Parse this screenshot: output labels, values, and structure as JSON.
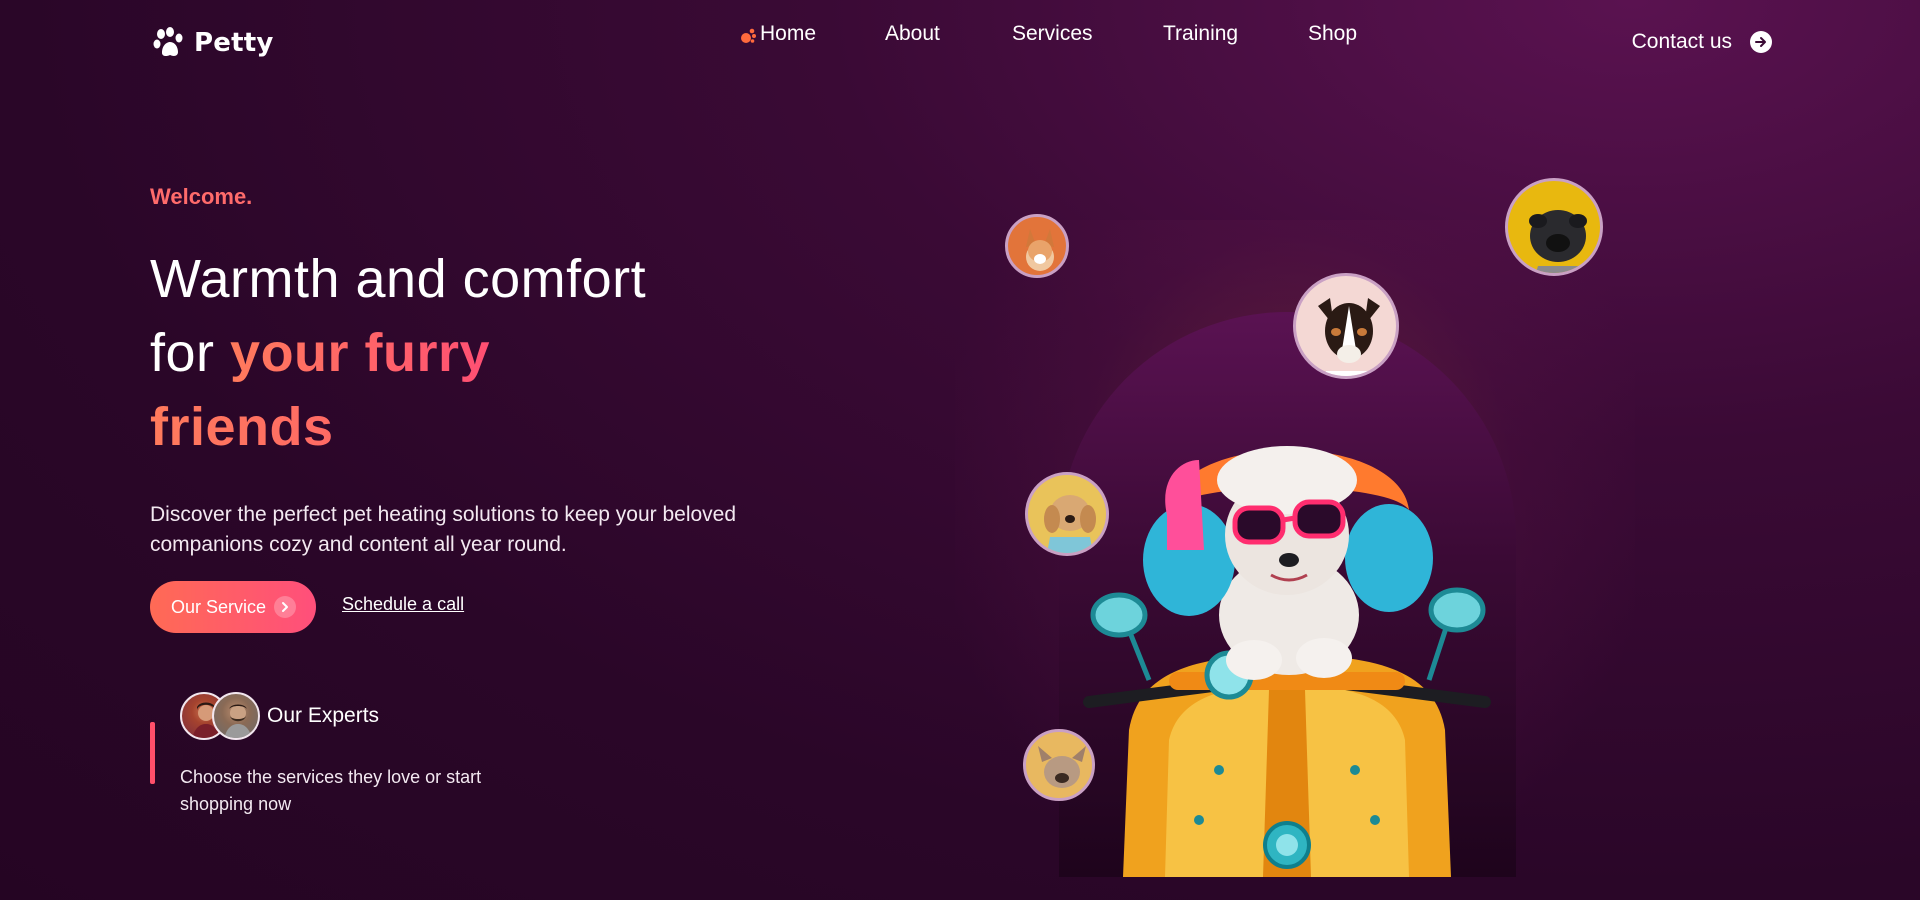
{
  "brand": {
    "name": "Petty",
    "logo_icon": "paw-icon"
  },
  "nav": {
    "items": [
      {
        "label": "Home",
        "active": true
      },
      {
        "label": "About",
        "active": false
      },
      {
        "label": "Services",
        "active": false
      },
      {
        "label": "Training",
        "active": false
      },
      {
        "label": "Shop",
        "active": false
      }
    ],
    "contact_label": "Contact us",
    "contact_icon": "arrow-right-circle-icon"
  },
  "hero": {
    "eyebrow": "Welcome.",
    "headline": {
      "line1": "Warmth and comfort",
      "line2_plain": "for ",
      "line2_highlight": "your furry",
      "line3_highlight": "friends"
    },
    "description": "Discover the perfect pet heating solutions to keep your beloved companions cozy and content all year round.",
    "primary_button": "Our Service",
    "secondary_link": "Schedule a call"
  },
  "experts": {
    "title": "Our Experts",
    "text": "Choose the services they love or start shopping now"
  },
  "colors": {
    "accent": "#ff5a6e",
    "accent_orange": "#ff7a5c",
    "background": "#2a0628",
    "bubble_border": "#c9a0c4"
  }
}
